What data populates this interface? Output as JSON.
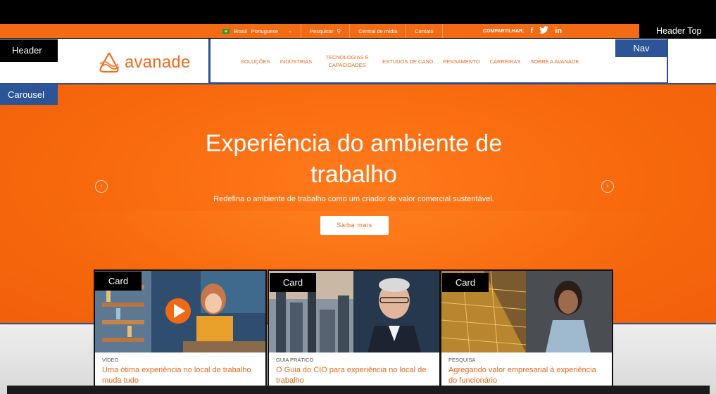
{
  "header_top": {
    "region": "Brasil",
    "language": "Portuguese",
    "search_label": "Pesquisar",
    "media_link": "Central de mídia",
    "contact_link": "Contato",
    "share_label": "COMPARTILHAR:",
    "social": [
      "f",
      "t",
      "in"
    ]
  },
  "header": {
    "logo_text": "avanade"
  },
  "nav": {
    "items": [
      "SOLUÇÕES",
      "INDÚSTRIAS",
      "TECNOLOGIAS E CAPACIDADES",
      "ESTUDOS DE CASO",
      "PENSAMENTO",
      "CARREIRAS",
      "SOBRE A AVANADE"
    ]
  },
  "hero": {
    "title_line1": "Experiência do ambiente de",
    "title_line2": "trabalho",
    "subtitle": "Redefina o ambiente de trabalho como um criador de valor comercial sustentável.",
    "button": "Saiba mais",
    "prev_arrow": "‹",
    "next_arrow": "›"
  },
  "cards": [
    {
      "type": "VÍDEO",
      "title": "Uma ótima experiência no local de trabalho muda tudo"
    },
    {
      "type": "GUIA PRÁTICO",
      "title": "O Guia do CIO para experiência no local de trabalho"
    },
    {
      "type": "PESQUISA",
      "title": "Agregando valor empresarial à experiência do funcionário"
    }
  ],
  "annotations": {
    "header_top": "Header Top",
    "header": "Header",
    "nav": "Nav",
    "carousel": "Carousel",
    "card": "Card"
  },
  "colors": {
    "brand_orange": "#f46b16",
    "annotation_blue": "#2b5597"
  }
}
